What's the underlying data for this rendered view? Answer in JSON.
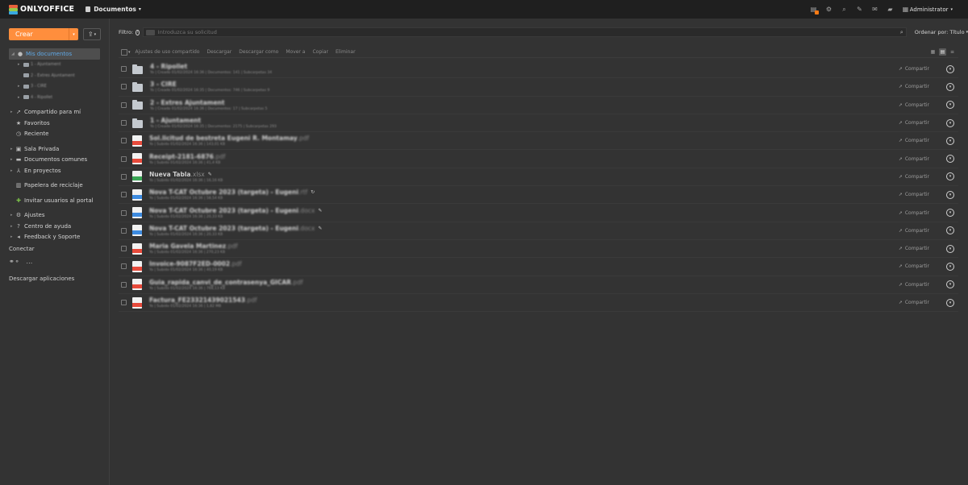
{
  "app": {
    "logo_text": "ONLYOFFICE",
    "module_label": "Documentos",
    "user": "Administrator",
    "header_icons": [
      "documents-icon",
      "gear-icon",
      "search-icon",
      "feed-icon",
      "mail-icon",
      "chat-icon",
      "calendar-icon"
    ]
  },
  "sidebar": {
    "create_label": "Crear",
    "tree": [
      {
        "label": "Mis documentos",
        "icon": "user-icon",
        "selected": true
      },
      {
        "label": "1 - Ajuntament",
        "sub": true
      },
      {
        "label": "2 - Extres Ajuntament",
        "sub": true
      },
      {
        "label": "3 - CIRE",
        "sub": true
      },
      {
        "label": "4 - Ripollet",
        "sub": true
      },
      {
        "label": "Compartido para mí",
        "icon": "share-icon"
      },
      {
        "label": "Favoritos",
        "icon": "star-icon"
      },
      {
        "label": "Reciente",
        "icon": "clock-icon"
      },
      {
        "label": "Sala Privada",
        "icon": "lock-icon"
      },
      {
        "label": "Documentos comunes",
        "icon": "folder-icon"
      },
      {
        "label": "En proyectos",
        "icon": "projects-icon"
      },
      {
        "label": "Papelera de reciclaje",
        "icon": "trash-icon"
      },
      {
        "label": "Invitar usuarios al portal",
        "icon": "plus-icon"
      },
      {
        "label": "Ajustes",
        "icon": "gear-icon"
      },
      {
        "label": "Centro de ayuda",
        "icon": "help-icon"
      },
      {
        "label": "Feedback y Soporte",
        "icon": "megaphone-icon"
      }
    ],
    "connect_label": "Conectar",
    "download_apps_label": "Descargar aplicaciones"
  },
  "filter": {
    "label": "Filtro:",
    "placeholder": "Introduzca su solicitud",
    "sort_label": "Ordenar por: Título"
  },
  "toolbar": {
    "buttons": [
      "Ajustes de uso compartido",
      "Descargar",
      "Descargar como",
      "Mover a",
      "Copiar",
      "Eliminar"
    ]
  },
  "files": [
    {
      "name": "4 - Ripollet",
      "ext": "",
      "type": "folder",
      "info": "Yo | Creado 01/02/2024 16:36 | Documentos: 141 | Subcarpetas 34"
    },
    {
      "name": "3 - CIRE",
      "ext": "",
      "type": "folder",
      "info": "Yo | Creado 01/02/2024 16:35 | Documentos: 746 | Subcarpetas 9"
    },
    {
      "name": "2 - Extres Ajuntament",
      "ext": "",
      "type": "folder",
      "info": "Yo | Creado 01/02/2024 16:36 | Documentos: 17 | Subcarpetas 5"
    },
    {
      "name": "1 - Ajuntament",
      "ext": "",
      "type": "folder",
      "info": "Yo | Creado 01/02/2024 16:35 | Documentos: 2175 | Subcarpetas 293"
    },
    {
      "name": "Sol.licitud de bestreta Eugeni R. Montamay",
      "ext": ".pdf",
      "type": "pdf",
      "info": "Yo | Subido 01/02/2024 16:36 | 143,01 KB"
    },
    {
      "name": "Receipt-2181-6876",
      "ext": ".pdf",
      "type": "pdf",
      "info": "Yo | Subido 01/02/2024 16:36 | 41,4 KB"
    },
    {
      "name": "Nueva Tabla",
      "ext": ".xlsx",
      "type": "xlsx",
      "info": "Yo | Subido 01/02/2024 16:36 | 16,16 KB",
      "clear": true,
      "edit": true
    },
    {
      "name": "Nova T-CAT Octubre 2023 (targeta) - Eugeni",
      "ext": ".rtf",
      "type": "doc",
      "info": "Yo | Subido 01/02/2024 16:36 | 58,54 KB",
      "sync": true
    },
    {
      "name": "Nova T-CAT Octubre 2023 (targeta) - Eugeni",
      "ext": ".docx",
      "type": "doc",
      "info": "Yo | Subido 01/02/2024 16:36 | 20,33 KB",
      "edit": true
    },
    {
      "name": "Nova T-CAT Octubre 2023 (targeta) - Eugeni",
      "ext": ".docx",
      "type": "doc",
      "info": "Yo | Subido 01/02/2024 16:36 | 20,33 KB",
      "edit": true
    },
    {
      "name": "Maria Gavela Martinez",
      "ext": ".pdf",
      "type": "pdf",
      "info": "Yo | Subido 01/02/2024 16:36 | 270,23 KB"
    },
    {
      "name": "Invoice-9087F2ED-0002",
      "ext": ".pdf",
      "type": "pdf",
      "info": "Yo | Subido 01/02/2024 16:36 | 40,19 KB"
    },
    {
      "name": "Guia_rapida_canvi_de_contrasenya_GICAR",
      "ext": ".pdf",
      "type": "pdf",
      "info": "Yo | Subido 01/02/2024 16:36 | 768,13 KB"
    },
    {
      "name": "Factura_FE23321439021543",
      "ext": ".pdf",
      "type": "pdf",
      "info": "Yo | Subido 01/02/2024 16:36 | 1,82 MB"
    }
  ],
  "share_label": "Compartir",
  "colors": {
    "accent": "#ff8e3d",
    "pdf": "#e74a3b",
    "xlsx": "#3aa655",
    "doc": "#3d8be0",
    "selected_text": "#5fa8e6"
  }
}
